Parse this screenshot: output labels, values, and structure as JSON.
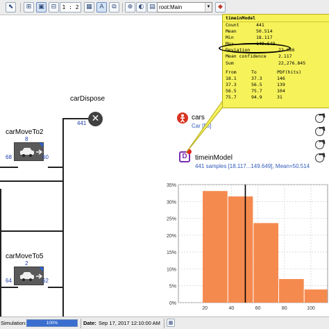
{
  "toolbar": {
    "scale_value": "1 : 2",
    "agent_selector": "root:Main",
    "colors": {
      "background": "#ececec",
      "button_icon": "#2d4a7a"
    },
    "buttons": [
      {
        "name": "pan-tool-button",
        "icon": "pointer-icon"
      },
      {
        "name": "zoom-in-button",
        "icon": "zoom-in-icon"
      },
      {
        "name": "zoom-out-button",
        "icon": "zoom-out-icon"
      },
      {
        "name": "toggle-grid-button",
        "icon": "grid-icon"
      },
      {
        "name": "show-agent-button",
        "icon": "agent-icon"
      },
      {
        "name": "navigate-button",
        "icon": "navigate-icon"
      }
    ]
  },
  "flowchart": {
    "car_dispose": {
      "label": "carDispose",
      "count": "441"
    },
    "car_move_to_2": {
      "label": "carMoveTo2",
      "top_count": "8",
      "in_count": "68",
      "out_count": "60"
    },
    "car_move_to_5": {
      "label": "carMoveTo5",
      "top_count": "2",
      "in_count": "64",
      "out_count": "62"
    },
    "line_color": "#202020"
  },
  "cars": {
    "label": "cars",
    "link": "Car [55]",
    "icon": "person-icon",
    "color": "#d9331f"
  },
  "stat": {
    "label": "timeinModel",
    "summary": "441 samples [18.117...149.649], Mean=50.514",
    "icon_letter": "D",
    "color": "#7a2ab0"
  },
  "tooltip": {
    "title": "timeinModel",
    "rows": [
      {
        "k": "Count",
        "v": "441"
      },
      {
        "k": "Mean",
        "v": "50.514"
      },
      {
        "k": "Min",
        "v": "18.117"
      },
      {
        "k": "Max",
        "v": "149.649"
      },
      {
        "k": "Deviation",
        "v": "22.686"
      },
      {
        "k": "Mean confidence",
        "v": "2.117"
      },
      {
        "k": "Sum",
        "v": "22,276.845"
      }
    ],
    "table_headers": [
      "From",
      "To",
      "PDF(hits)"
    ],
    "table_rows": [
      [
        "18.1",
        "37.3",
        "146"
      ],
      [
        "37.3",
        "56.5",
        "139"
      ],
      [
        "56.5",
        "75.7",
        "104"
      ],
      [
        "75.7",
        "94.9",
        "31"
      ]
    ],
    "background": "#f6f25a"
  },
  "chart_data": {
    "type": "bar",
    "title": "",
    "xlabel": "",
    "ylabel": "",
    "x_ticks": [
      20,
      40,
      60,
      80,
      100
    ],
    "y_ticks": [
      "0%",
      "5%",
      "10%",
      "15%",
      "20%",
      "25%",
      "30%",
      "35%"
    ],
    "xlim": [
      0,
      110
    ],
    "ylim": [
      0,
      35
    ],
    "bins": [
      {
        "from": 18.1,
        "to": 37.3,
        "value": 33.1
      },
      {
        "from": 37.3,
        "to": 56.5,
        "value": 31.5
      },
      {
        "from": 56.5,
        "to": 75.7,
        "value": 23.6
      },
      {
        "from": 75.7,
        "to": 94.9,
        "value": 7.0
      },
      {
        "from": 94.9,
        "to": 114.1,
        "value": 3.9
      }
    ],
    "mean_marker": 50.514,
    "bar_color": "#f58a4f",
    "grid": true
  },
  "status": {
    "simulation_label": "Simulation:",
    "progress": "100%",
    "date_label": "Date:",
    "date_value": "Sep 17, 2017 12:10:00 AM"
  }
}
